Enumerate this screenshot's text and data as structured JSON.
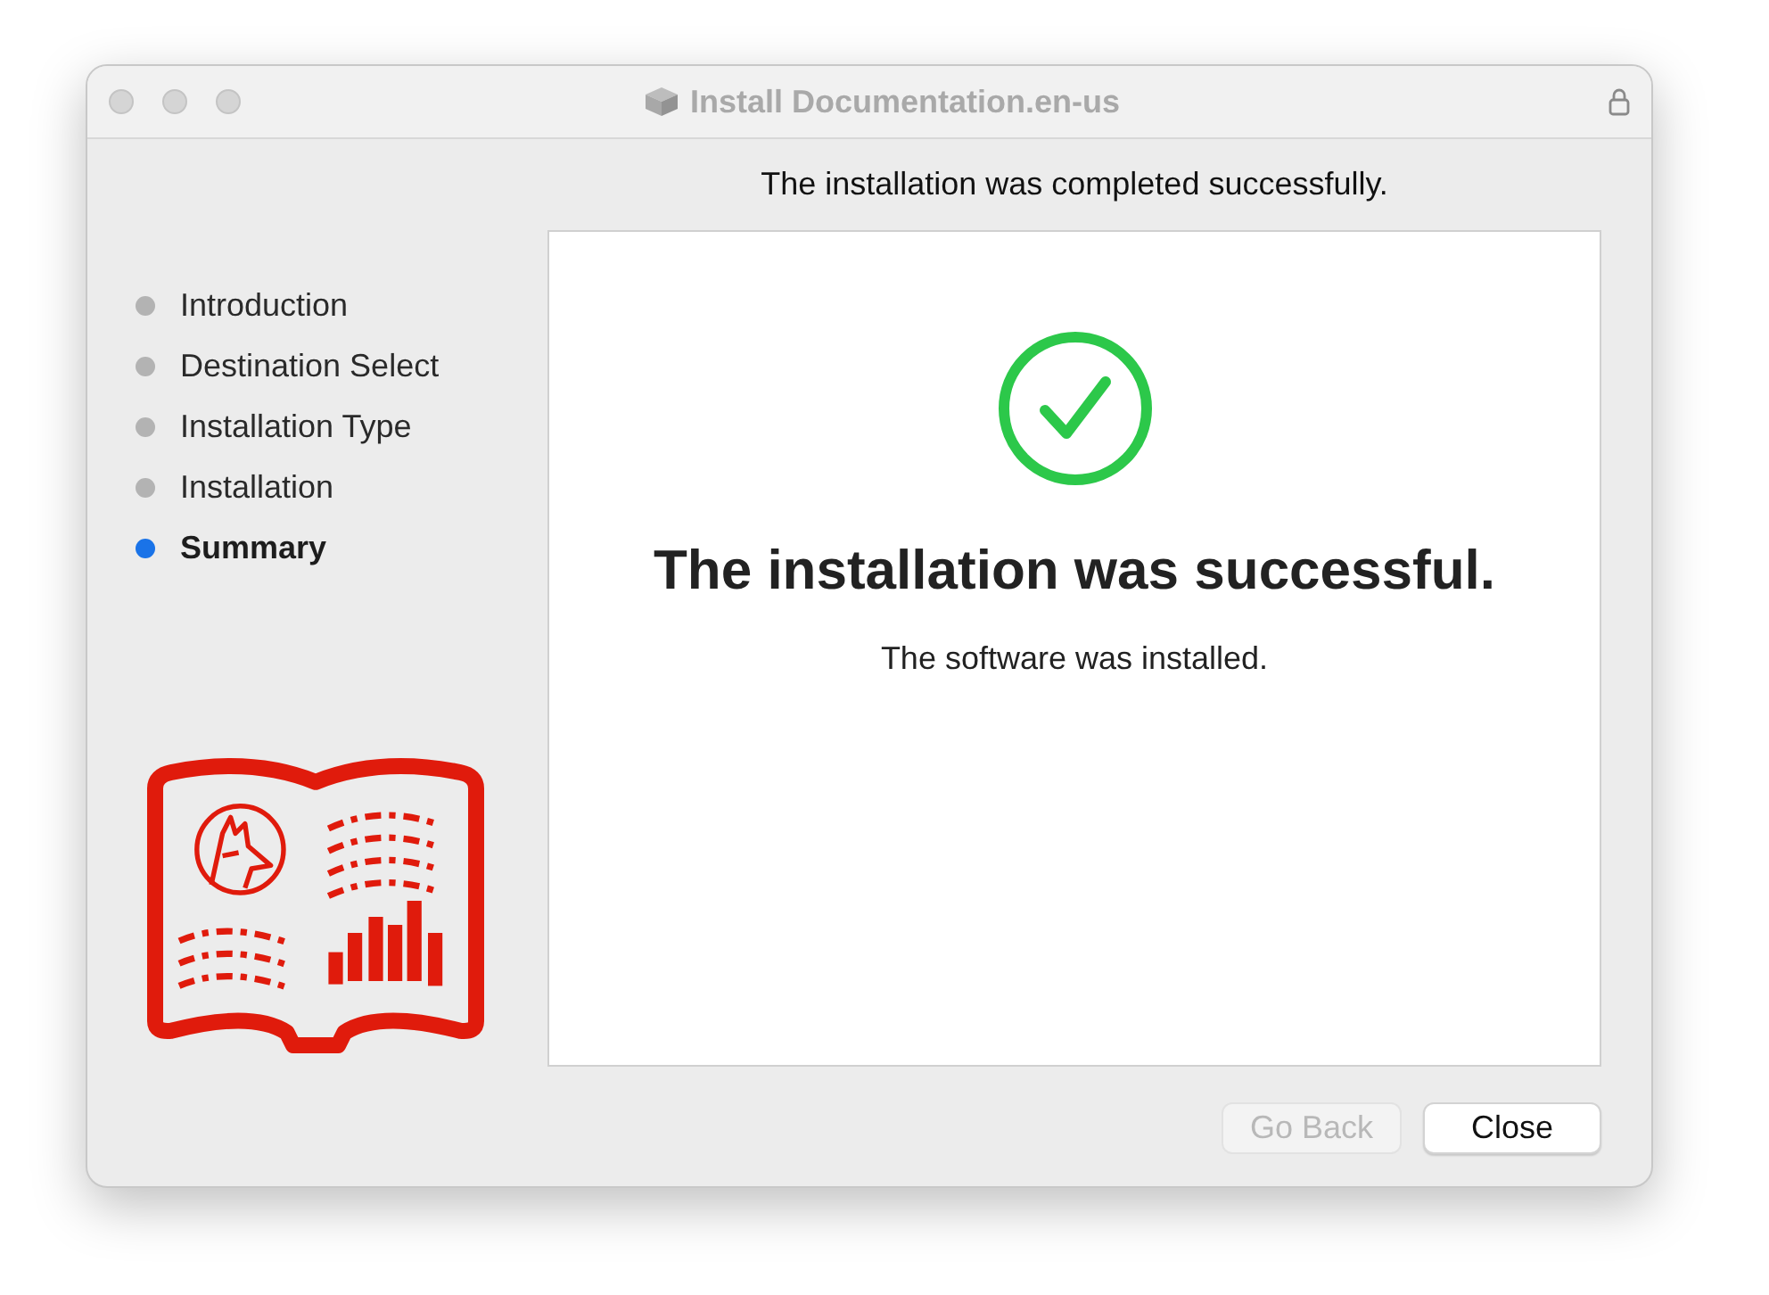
{
  "window": {
    "title": "Install Documentation.en-us"
  },
  "header": "The installation was completed successfully.",
  "steps": [
    {
      "label": "Introduction",
      "selected": false
    },
    {
      "label": "Destination Select",
      "selected": false
    },
    {
      "label": "Installation Type",
      "selected": false
    },
    {
      "label": "Installation",
      "selected": false
    },
    {
      "label": "Summary",
      "selected": true
    }
  ],
  "result": {
    "title": "The installation was successful.",
    "message": "The software was installed."
  },
  "buttons": [
    {
      "label": "Go Back",
      "disabled": true
    },
    {
      "label": "Close",
      "disabled": false
    }
  ]
}
